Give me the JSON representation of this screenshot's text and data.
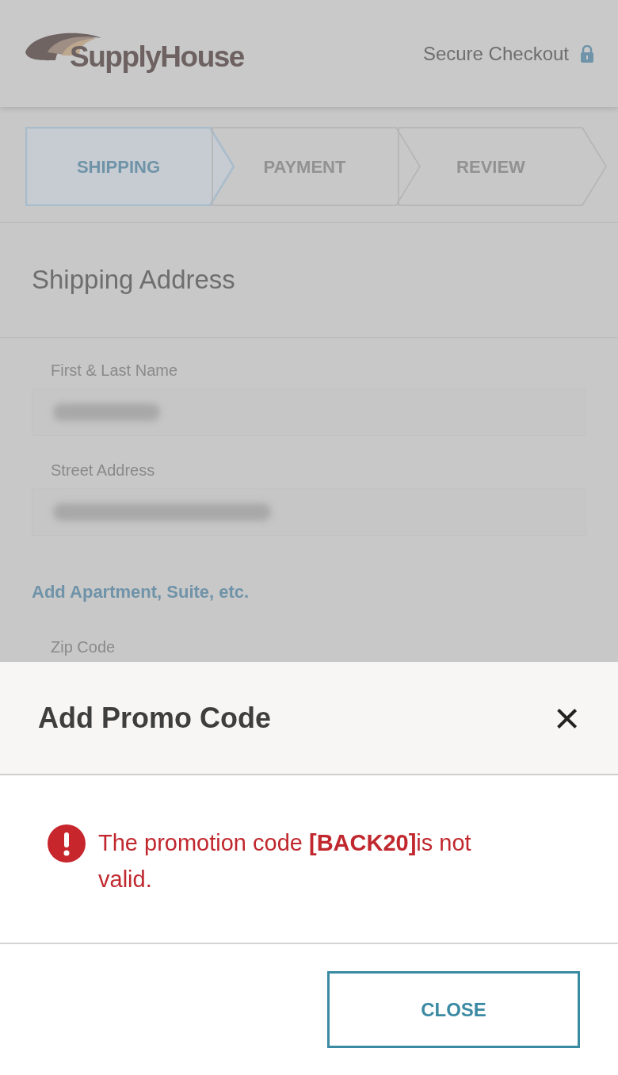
{
  "header": {
    "logo": "SupplyHouse",
    "secure_label": "Secure Checkout"
  },
  "steps": [
    {
      "label": "SHIPPING",
      "selected": true
    },
    {
      "label": "PAYMENT",
      "selected": false
    },
    {
      "label": "REVIEW",
      "selected": false
    }
  ],
  "section_title": "Shipping Address",
  "fields": [
    {
      "label": "First & Last Name"
    },
    {
      "label": "Street Address"
    }
  ],
  "add_link": "Add Apartment, Suite, etc.",
  "next_field": {
    "label": "Zip Code"
  },
  "modal": {
    "title": "Add Promo Code",
    "close_icon": "×",
    "message": "The promotion code **[BACK20]**is not valid.",
    "button": "CLOSE"
  }
}
